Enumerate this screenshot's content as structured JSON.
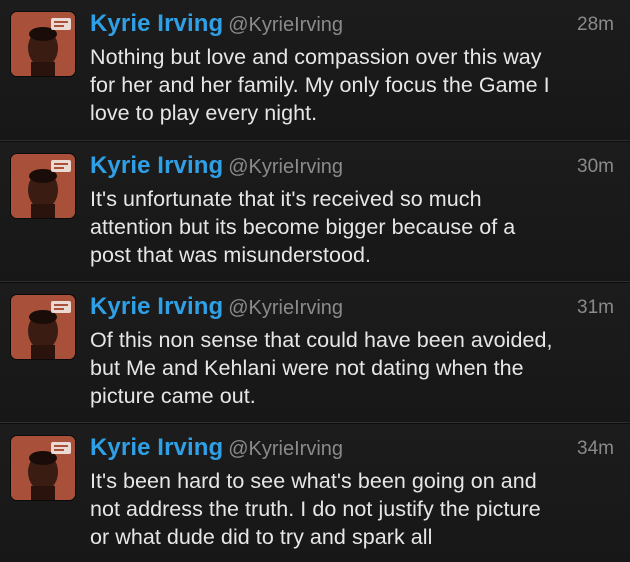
{
  "colors": {
    "name": "#2fa0e6",
    "meta": "#8a8a8a",
    "text": "#e6e6e6",
    "background": "#181818"
  },
  "tweets": [
    {
      "name": "Kyrie Irving",
      "handle": "@KyrieIrving",
      "time": "28m",
      "lines": [
        "Nothing but love and compassion over this way",
        "for her and her family. My only focus the Game I",
        "love to play every night."
      ],
      "avatar_icon": "user-avatar"
    },
    {
      "name": "Kyrie Irving",
      "handle": "@KyrieIrving",
      "time": "30m",
      "lines": [
        "It's unfortunate that it's received so much",
        "attention but its become bigger because of a",
        "post that was misunderstood."
      ],
      "avatar_icon": "user-avatar"
    },
    {
      "name": "Kyrie Irving",
      "handle": "@KyrieIrving",
      "time": "31m",
      "lines": [
        "Of this non sense that could have been avoided,",
        "but Me and Kehlani were not dating when the",
        "picture came out."
      ],
      "avatar_icon": "user-avatar"
    },
    {
      "name": "Kyrie Irving",
      "handle": "@KyrieIrving",
      "time": "34m",
      "lines": [
        "It's been hard to see what's been going on and",
        "not address the truth. I do not justify the picture",
        "or what dude did to try and spark all"
      ],
      "avatar_icon": "user-avatar"
    }
  ]
}
